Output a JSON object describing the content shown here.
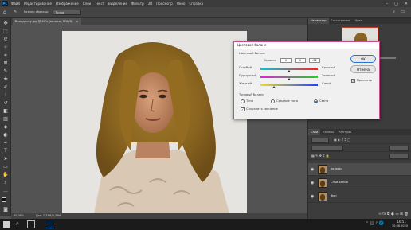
{
  "app": {
    "logo": "Ps"
  },
  "menu": [
    "Файл",
    "Редактирование",
    "Изображение",
    "Слои",
    "Текст",
    "Выделение",
    "Фильтр",
    "3D",
    "Просмотр",
    "Окно",
    "Справка"
  ],
  "options_bar": {
    "size_label": "Размер образца:",
    "size_value": "Точка"
  },
  "document_tab": {
    "title": "Блондинку.jpg @ 40% (волосы, RGB/8)"
  },
  "status_bar": {
    "zoom": "40,08%",
    "doc_size": "Док: 2,33М/8,39М"
  },
  "right_panel": {
    "tabs_top": [
      "Навигатор",
      "Гистограмма",
      "Цвет"
    ],
    "tabs_layers": [
      "Слои",
      "Каналы",
      "Контуры"
    ],
    "layers": [
      {
        "name": "волосы",
        "selected": true
      },
      {
        "name": "Слой-копия",
        "selected": false
      },
      {
        "name": "Фон",
        "selected": false
      }
    ]
  },
  "dialog": {
    "title": "Цветовой баланс",
    "section_balance": "Цветовой баланс",
    "levels_label": "Уровни:",
    "levels": [
      "0",
      "0",
      "-52"
    ],
    "sliders": [
      {
        "left": "Голубой",
        "right": "Красный",
        "value": 0
      },
      {
        "left": "Пурпурный",
        "right": "Зеленый",
        "value": 0
      },
      {
        "left": "Желтый",
        "right": "Синий",
        "value": -52
      }
    ],
    "tone_section": "Тоновый баланс",
    "tones": [
      {
        "label": "Тени",
        "selected": false
      },
      {
        "label": "Средние тона",
        "selected": false
      },
      {
        "label": "Света",
        "selected": true
      }
    ],
    "preserve_luminosity": {
      "label": "Сохранить свечение",
      "checked": true
    },
    "ok": "OK",
    "cancel": "Отмена",
    "preview": {
      "label": "Просмотр",
      "checked": true
    }
  },
  "taskbar": {
    "time": "16:51",
    "date": "30.06.2020"
  },
  "colors": {
    "accent_border": "#c44d8c",
    "ok_outline": "#2a73d6"
  }
}
